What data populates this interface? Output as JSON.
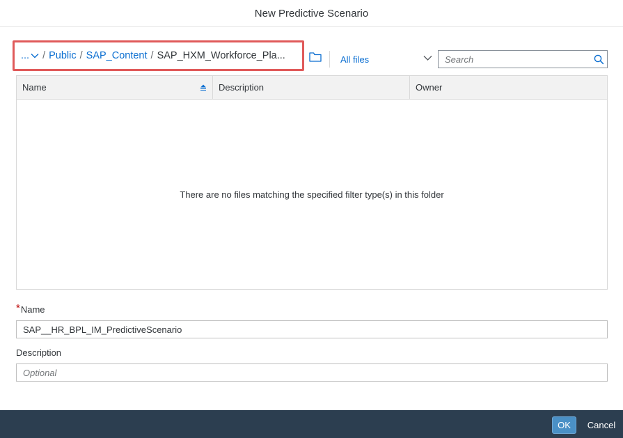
{
  "dialog": {
    "title": "New Predictive Scenario"
  },
  "breadcrumb": {
    "more": "...",
    "separator": "/",
    "items": [
      "Public",
      "SAP_Content"
    ],
    "current": "SAP_HXM_Workforce_Pla..."
  },
  "filter": {
    "value": "All files"
  },
  "search": {
    "placeholder": "Search"
  },
  "table": {
    "columns": [
      "Name",
      "Description",
      "Owner"
    ],
    "empty_message": "There are no files matching the specified filter type(s) in this folder"
  },
  "form": {
    "required_marker": "*",
    "name_label": "Name",
    "name_value": "SAP__HR_BPL_IM_PredictiveScenario",
    "description_label": "Description",
    "description_placeholder": "Optional"
  },
  "footer": {
    "ok_label": "OK",
    "cancel_label": "Cancel"
  },
  "colors": {
    "link": "#0a6ed1",
    "highlight_border": "#e05a5a",
    "footer_bg": "#2c3e50",
    "ok_button": "#4a90c6",
    "required": "#bb0000"
  },
  "icons": {
    "more": "chevron-down-icon",
    "folder": "folder-icon",
    "filter": "chevron-down-icon",
    "search": "search-icon",
    "sort": "sort-ascending-icon"
  }
}
